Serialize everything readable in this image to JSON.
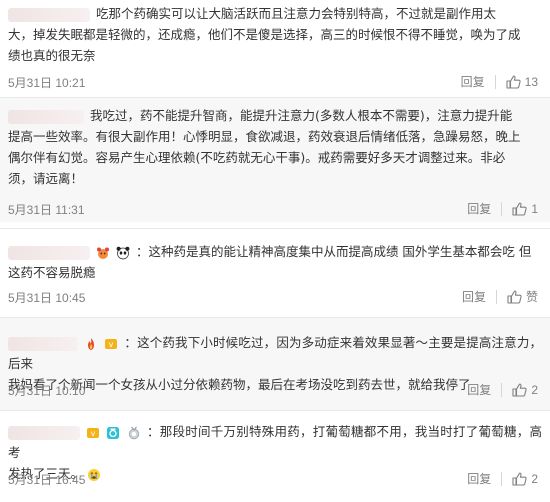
{
  "labels": {
    "reply": "回复"
  },
  "colors": {
    "meta_text": "#808080",
    "body_text": "#333333",
    "shaded_bg": "#f7f7f7",
    "divider": "#e8e8e8"
  },
  "comments": [
    {
      "lines": [
        "吃那个药确实可以让大脑活跃而且注意力会特别特高，不过就是副作用太",
        "大，掉发失眠都是轻微的，还成瘾，他们不是傻是选择，高三的时候恨不得不睡觉，唤为了成",
        "绩也真的很无奈"
      ],
      "date": "5月31日 10:21",
      "likes": "13",
      "like_icon": "thumbs-up-icon"
    },
    {
      "lines": [
        "我吃过，药不能提升智商，能提升注意力(多数人根本不需要)，注意力提升能",
        "提高一些效率。有很大副作用！心悸明显，食欲减退，药效衰退后情绪低落，急躁易怒，晚上",
        "偶尔伴有幻觉。容易产生心理依赖(不吃药就无心干事)。戒药需要好多天才调整过来。非必",
        "须，请远离！"
      ],
      "date": "5月31日 11:31",
      "likes": "1",
      "like_icon": "thumbs-up-icon"
    },
    {
      "lines": [
        "：这种药是真的能让精神高度集中从而提高成绩 国外学生基本都会吃 但",
        "这药不容易脱瘾"
      ],
      "badges": [
        "cartoon-bear-badge-icon",
        "panda-badge-icon"
      ],
      "date": "5月31日 10:45",
      "likes": "赞",
      "like_icon": "thumbs-up-icon"
    },
    {
      "lines": [
        "：这个药我下小时候吃过，因为多动症来着效果显著～主要是提高注意力，后来",
        "我妈看了个新闻一个女孩从小过分依赖药物，最后在考场没吃到药去世，就给我停了"
      ],
      "badges": [
        "flame-badge-icon",
        "gold-badge-icon"
      ],
      "date": "5月31日 10:10",
      "likes": "2",
      "like_icon": "thumbs-up-icon"
    },
    {
      "lines": [
        "：那段时间千万别特殊用药，打葡萄糖都不用，我当时打了葡萄糖，高考",
        "发热了三天。"
      ],
      "badges": [
        "gold-badge-icon",
        "camera-badge-icon",
        "medal-badge-icon"
      ],
      "end_emoji": "sob-emoji-icon",
      "date": "5月31日 16:45",
      "likes": "2",
      "like_icon": "thumbs-up-icon"
    }
  ]
}
